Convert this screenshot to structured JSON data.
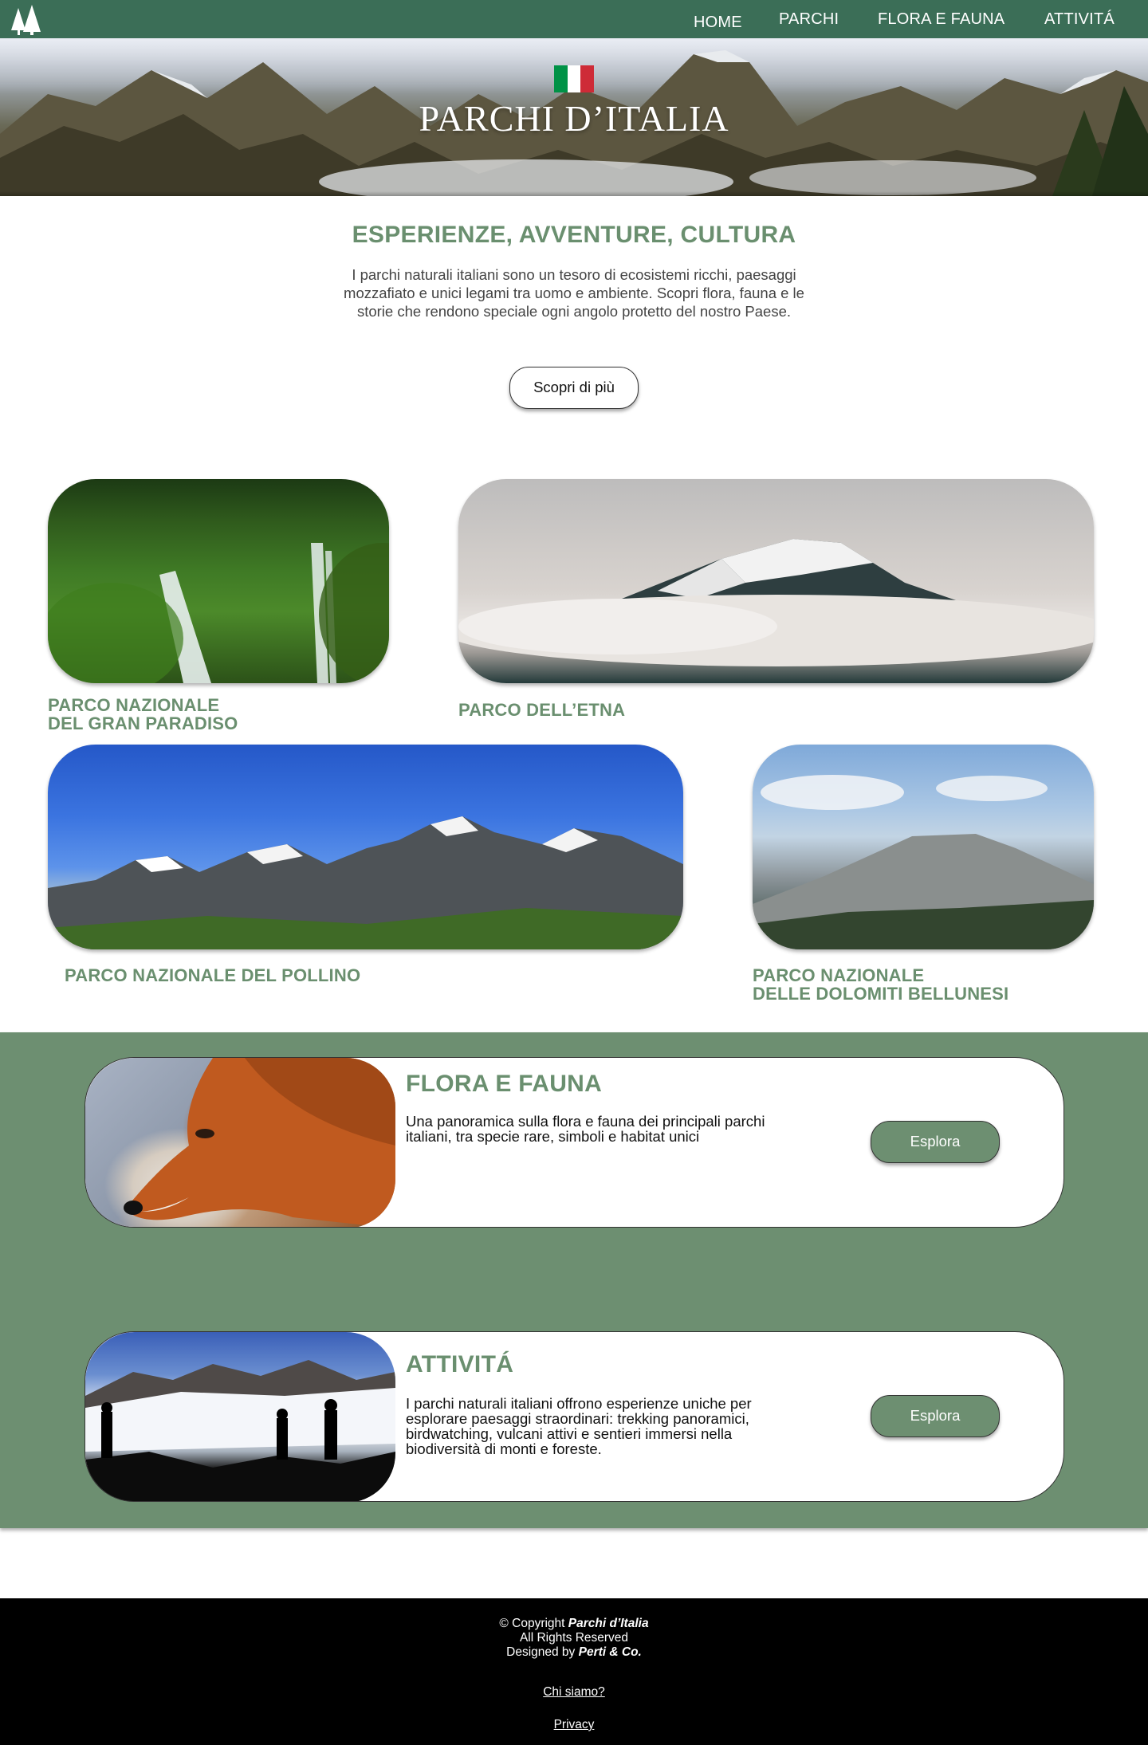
{
  "nav": {
    "logo": "tree-logo",
    "items": [
      {
        "label": "HOME"
      },
      {
        "label": "PARCHI"
      },
      {
        "label": "FLORA E FAUNA"
      },
      {
        "label": "ATTIVITÁ"
      }
    ]
  },
  "hero": {
    "title": "PARCHI D’ITALIA",
    "flag_colors": [
      "#009246",
      "#ffffff",
      "#ce2b37"
    ]
  },
  "intro": {
    "title": "ESPERIENZE, AVVENTURE, CULTURA",
    "text": "I parchi naturali italiani sono un tesoro di ecosistemi ricchi, paesaggi mozzafiato e unici legami tra uomo e ambiente. Scopri flora, fauna e le storie che rendono speciale ogni angolo protetto del nostro Paese.",
    "button": "Scopri di più"
  },
  "parks": [
    {
      "line1": "PARCO NAZIONALE",
      "line2": "DEL GRAN PARADISO"
    },
    {
      "line1": "PARCO DELL’ETNA",
      "line2": ""
    },
    {
      "line1": "PARCO NAZIONALE DEL POLLINO",
      "line2": ""
    },
    {
      "line1": "PARCO NAZIONALE",
      "line2": "DELLE DOLOMITI BELLUNESI"
    }
  ],
  "features": [
    {
      "title": "FLORA E FAUNA",
      "text": "Una panoramica sulla flora e fauna dei principali parchi italiani, tra specie rare, simboli e habitat unici",
      "button": "Esplora"
    },
    {
      "title": "ATTIVITÁ",
      "text": "I parchi naturali italiani offrono esperienze uniche per esplorare paesaggi straordinari: trekking panoramici, birdwatching, vulcani attivi e sentieri immersi nella biodiversità di monti e foreste.",
      "button": "Esplora"
    }
  ],
  "footer": {
    "copyright_prefix": "© Copyright ",
    "copyright_brand": "Parchi d’Italia",
    "rights": "All Rights Reserved",
    "designed_prefix": "Designed by ",
    "designed_brand": "Perti & Co.",
    "link_about": "Chi siamo?",
    "link_privacy": "Privacy"
  },
  "colors": {
    "nav_bg": "#3b6e57",
    "accent_green": "#6a8f6f",
    "band_green": "#6d8f71",
    "footer_bg": "#000000"
  }
}
